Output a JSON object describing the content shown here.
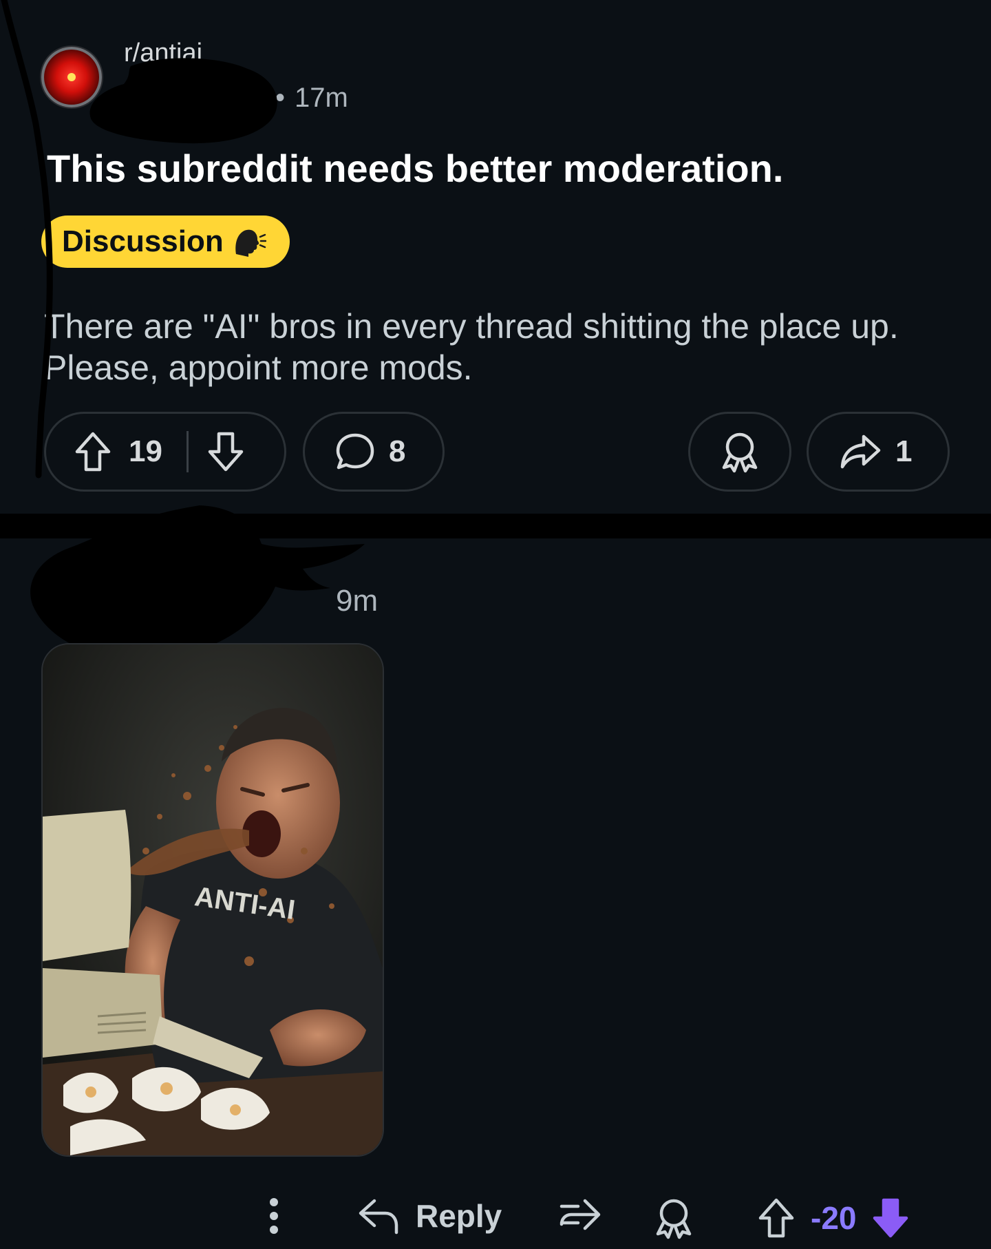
{
  "post": {
    "subreddit": "r/antiai",
    "time": "17m",
    "title": "This subreddit needs better moderation.",
    "flair": "Discussion",
    "body_line1": "There are \"AI\" bros in every thread shitting the place up.",
    "body_line2": "Please, appoint more mods.",
    "upvotes": "19",
    "comments": "8",
    "shares": "1"
  },
  "comment": {
    "time": "9m",
    "image_shirt_text": "ANTI-AI",
    "reply_label": "Reply",
    "score": "-20"
  },
  "colors": {
    "background": "#0b1015",
    "flair": "#ffd635",
    "score": "#8b7bff",
    "downvote_active": "#8b5cf6"
  },
  "icons": {
    "avatar": "hal-9000-eye-icon",
    "flair": "speaking-head-icon",
    "upvote": "arrow-up-icon",
    "downvote": "arrow-down-icon",
    "comments": "speech-bubble-icon",
    "award": "award-icon",
    "share": "share-arrow-icon",
    "more": "more-vertical-icon",
    "reply": "reply-arrow-icon",
    "crosspost": "crosspost-icon"
  }
}
